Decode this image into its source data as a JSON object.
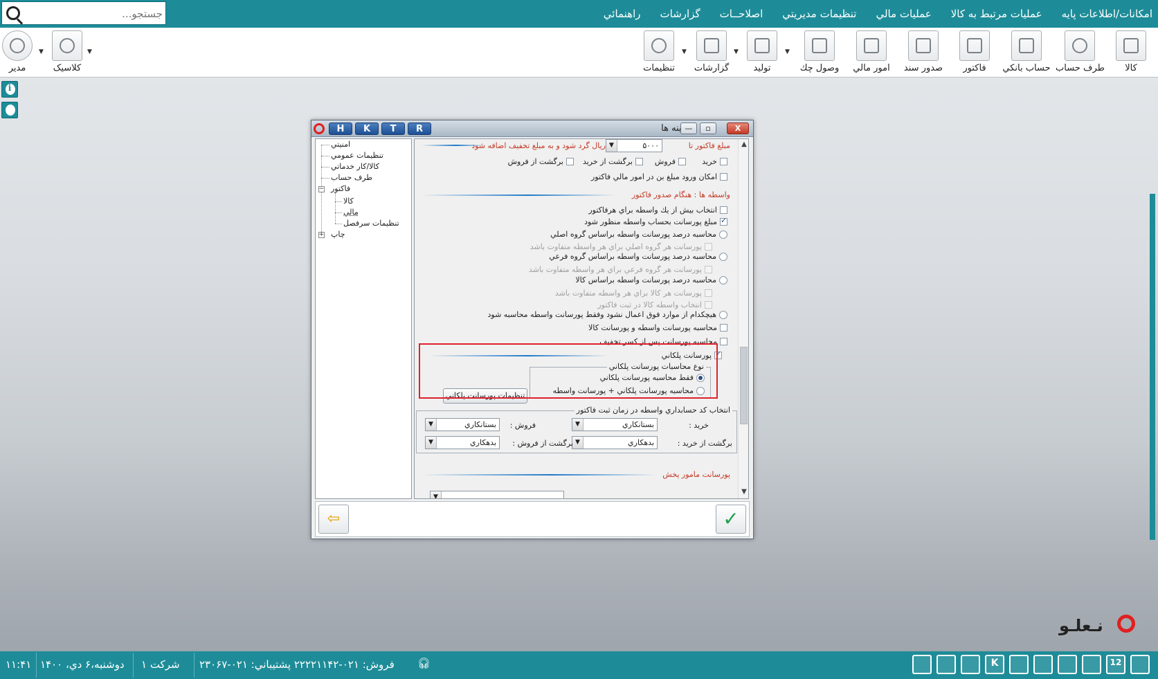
{
  "search": {
    "placeholder": "جستجو..."
  },
  "menu": [
    "امکانات/اطلاعات پايه",
    "عمليات مرتبط به کالا",
    "عمليات مالي",
    "تنظيمات مديريتي",
    "اصلاحــات",
    "گزارشات",
    "راهنمائي"
  ],
  "toolbar": {
    "kala": "کالا",
    "taraf_hesab": "طرف حساب",
    "hesab_banki": "حساب بانکي",
    "factor": "فاکتور",
    "sodur_sanad": "صدور سند",
    "omur_mali": "امور مالي",
    "vosul_chek": "وصول چك",
    "tolid": "توليد",
    "gozareshat": "گزارشات",
    "tanzimat": "تنظيمات",
    "classic": "کلاسيک",
    "modir": "مدير"
  },
  "dialog": {
    "title": "گزينه ها",
    "hotkeys": [
      "H",
      "K",
      "T",
      "R"
    ],
    "close_label": "X",
    "tree": {
      "amniati": "امنيتي",
      "tanzimat_omumi": "تنظيمات عمومي",
      "kala_khadamat": "کالا/کار خدماتي",
      "taraf_hesab": "طرف حساب",
      "factor": "فاکتور",
      "kala": "کالا",
      "mali": "مالي",
      "sarfasl": "تنظيمات سرفصل",
      "chap": "چاپ"
    },
    "opts": {
      "round_label": "مبلغ فاکتور تا",
      "round_value": "۵۰۰۰",
      "round_suffix": "ريال گرد شود و به مبلغ تخفيف اضافه شود",
      "kharid": "خريد",
      "forush": "فروش",
      "bargasht_kharid": "برگشت از خريد",
      "bargasht_forush": "برگشت از فروش",
      "mali_input": "امکان ورود مبلغ بن در امور مالي فاکتور",
      "vaseteh_head": "واسطه ها : هنگام صدور فاکتور",
      "multi_vaseteh": "انتخاب بيش از يك واسطه براي هرفاکتور",
      "porsant_account": "مبلغ پورسانت بحساب واسطه منظور شود",
      "calc_group": "محاسبه درصد پورسانت واسطه براساس گروه اصلي",
      "diff_group": "پورسانت هر گروه اصلي براي هر واسطه متفاوت باشد",
      "calc_subgroup": "محاسبه درصد پورسانت واسطه براساس گروه فرعي",
      "diff_subgroup": "پورسانت هر گروه فرعي براي هر واسطه متفاوت باشد",
      "calc_kala": "محاسبه درصد پورسانت واسطه براساس کالا",
      "diff_kala": "پورسانت هر کالا براي هر واسطه متفاوت باشد",
      "select_kala": "انتخاب واسطه کالا در ثبت فاکتور",
      "none": "هيچكدام از موارد فوق اعمال نشود وفقط پورسانت واسطه محاسبه شود",
      "calc_vaseteh_kala": "محاسبه پورسانت واسطه و پورسانت کالا",
      "after_discount": "محاسبه پورسانت پس از کسر تخفيف",
      "pelekani": "پورسانت پلکاني",
      "pelekani_type": "نوع محاسبات پورسانت پلکاني",
      "only_pelekani": "فقط محاسبه پورسانت پلکاني",
      "pelekani_plus": "محاسبه پورسانت پلکاني  +  پورسانت واسطه",
      "pelekani_settings": "تنظيمات پورسانت پلکاني",
      "acc_group": "انتخاب کد حسابداري واسطه در زمان ثبت فاکتور",
      "acc_kharid": "خريد :",
      "acc_forush": "فروش :",
      "acc_bargasht_kharid": "برگشت از خريد :",
      "acc_bargasht_forush": "برگشت از فروش :",
      "bestankari": "بستانکاري",
      "bedehkari": "بدهکاري",
      "mamur_head": "پورسانت مامور پخش"
    }
  },
  "status": {
    "time": "۱۱:۴۱",
    "date": "دوشنبه،۶ دي، ۱۴۰۰",
    "company": "شرکت ۱",
    "phones": "فروش:  ۰۲۱-۲۲۲۲۱۱۴۲  پشتيباني:  ۰۲۱-۲۳۰۶۷",
    "calendar_day": "12",
    "k_label": "K"
  },
  "brand": {
    "name": "نـعلـو"
  },
  "colors": {
    "bar": "#1d8c98",
    "highlight": "#e0202c",
    "section_head": "#c43a26"
  }
}
